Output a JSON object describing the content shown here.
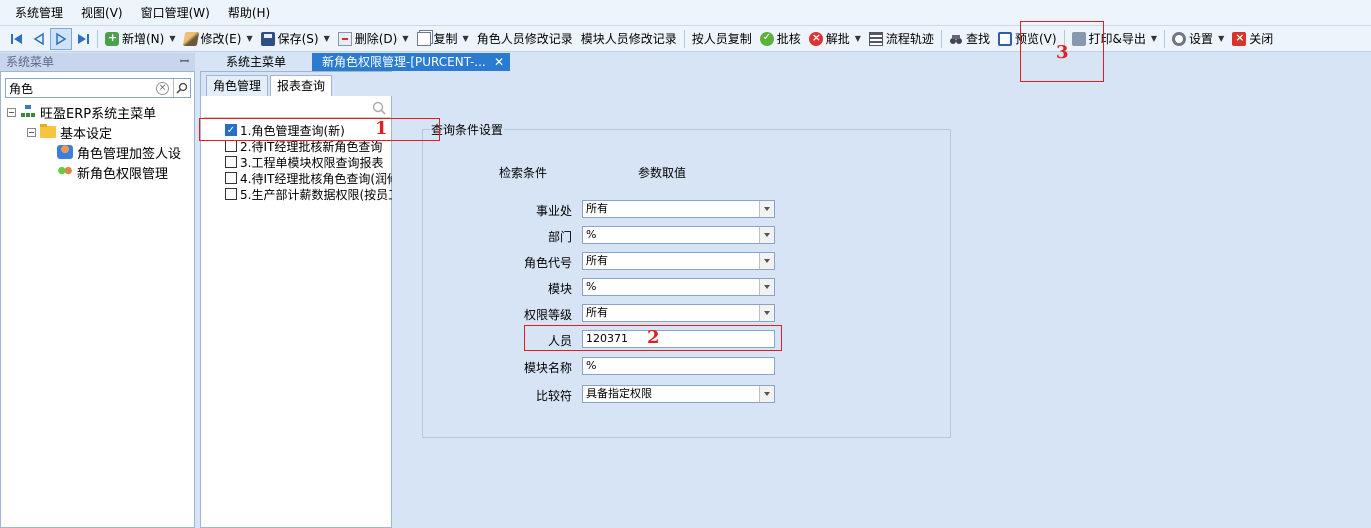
{
  "menubar": [
    "系统管理",
    "视图(V)",
    "窗口管理(W)",
    "帮助(H)"
  ],
  "toolbar": {
    "new": "新增(N)",
    "edit": "修改(E)",
    "save": "保存(S)",
    "delete": "删除(D)",
    "copy": "复制",
    "role_log": "角色人员修改记录",
    "module_log": "模块人员修改记录",
    "copy_by_person": "按人员复制",
    "approve": "批核",
    "unapprove": "解批",
    "flow": "流程轨迹",
    "find": "查找",
    "preview": "预览(V)",
    "print": "打印&导出",
    "settings": "设置",
    "close": "关闭"
  },
  "sidebar": {
    "header": "系统菜单",
    "search_value": "角色",
    "tree": {
      "root": "旺盈ERP系统主菜单",
      "folder": "基本设定",
      "items": [
        "角色管理加签人设",
        "新角色权限管理"
      ]
    }
  },
  "tabs": {
    "main_menu": "系统主菜单",
    "active": "新角色权限管理-[PURCENT-..."
  },
  "subtabs": [
    "角色管理",
    "报表查询"
  ],
  "report_list": [
    {
      "label": "1.角色管理查询(新)",
      "checked": true
    },
    {
      "label": "2.待IT经理批核新角色查询",
      "checked": false
    },
    {
      "label": "3.工程单模块权限查询报表",
      "checked": false
    },
    {
      "label": "4.待IT经理批核角色查询(润修",
      "checked": false
    },
    {
      "label": "5.生产部计薪数据权限(按员工",
      "checked": false
    }
  ],
  "query": {
    "legend": "查询条件设置",
    "col_condition": "检索条件",
    "col_value": "参数取值",
    "fields": [
      {
        "label": "事业处",
        "value": "所有",
        "dropdown": true
      },
      {
        "label": "部门",
        "value": "%",
        "dropdown": true
      },
      {
        "label": "角色代号",
        "value": "所有",
        "dropdown": true
      },
      {
        "label": "模块",
        "value": "%",
        "dropdown": true
      },
      {
        "label": "权限等级",
        "value": "所有",
        "dropdown": true
      },
      {
        "label": "人员",
        "value": "120371",
        "dropdown": false
      },
      {
        "label": "模块名称",
        "value": "%",
        "dropdown": false
      },
      {
        "label": "比较符",
        "value": "具备指定权限",
        "dropdown": true
      }
    ]
  },
  "annotations": [
    "1",
    "2",
    "3"
  ],
  "colors": {
    "annotation": "#e02020",
    "active_tab": "#2b7bd0",
    "background": "#d6e4f5"
  }
}
